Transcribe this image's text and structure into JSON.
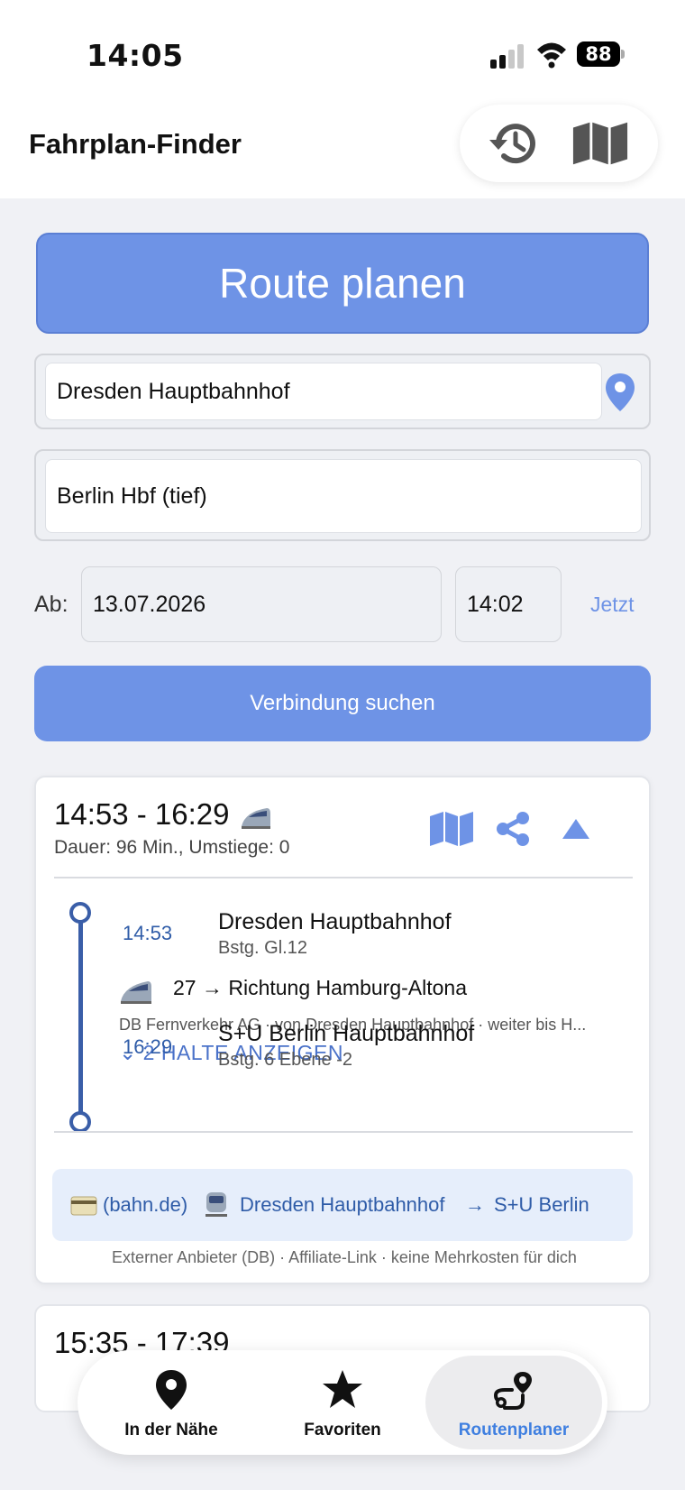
{
  "status": {
    "time": "14:05",
    "battery": "88"
  },
  "header": {
    "title": "Fahrplan-Finder",
    "history_icon": "history-icon",
    "map_icon": "map-icon"
  },
  "planner": {
    "banner": "Route planen",
    "from_value": "Dresden Hauptbahnhof",
    "to_value": "Berlin Hbf (tief)",
    "departure_label": "Ab:",
    "date": "13.07.2026",
    "time": "14:02",
    "now_label": "Jetzt",
    "search_label": "Verbindung suchen"
  },
  "connection": {
    "times": "14:53 - 16:29",
    "summary": "Dauer: 96 Min., Umstiege: 0",
    "origin": {
      "time": "14:53",
      "name": "Dresden Hauptbahnhof",
      "platform": "Bstg. Gl.12"
    },
    "leg": {
      "line": "27 → Richtung Hamburg-Altona",
      "detail": "DB Fernverkehr AG · von Dresden Hauptbahnhof · weiter bis H...",
      "halts_label": "2 HALTE ANZEIGEN"
    },
    "destination": {
      "time": "16:29",
      "name": "S+U Berlin Hauptbahnhof",
      "platform": "Bstg. 6  Ebene -2"
    },
    "booking": {
      "provider": "(bahn.de)",
      "from": "Dresden Hauptbahnhof",
      "arrow": "→",
      "to": "S+U Berlin"
    },
    "booking_note": "Externer Anbieter (DB) · Affiliate-Link · keine Mehrkosten für dich"
  },
  "next_connection": {
    "times": "15:35 - 17:39"
  },
  "tabs": [
    {
      "label": "In der Nähe",
      "icon": "location-pin-icon",
      "active": false
    },
    {
      "label": "Favoriten",
      "icon": "star-icon",
      "active": false
    },
    {
      "label": "Routenplaner",
      "icon": "route-icon",
      "active": true
    }
  ],
  "colors": {
    "accent": "#6e93e6",
    "timeline": "#3a5ea8",
    "active_tab": "#3f7fe0"
  }
}
